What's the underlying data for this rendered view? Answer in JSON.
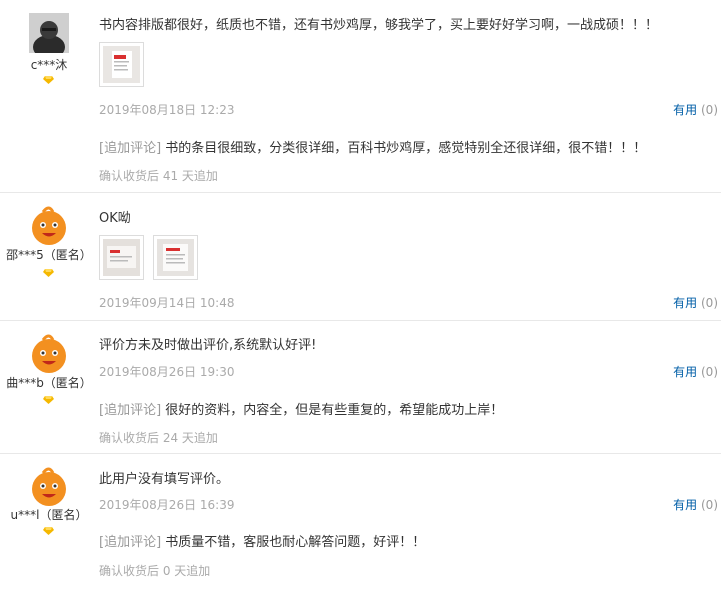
{
  "reviews": [
    {
      "user": "c***沐",
      "content": "书内容排版都很好，纸质也不错，还有书炒鸡厚，够我学了，买上要好好学习啊，一战成硕！！！",
      "date": "2019年08月18日 12:23",
      "useful_label": "有用",
      "useful_count": "(0)",
      "append_tag": "[追加评论]",
      "append_text": "书的条目很细致，分类很详细，百科书炒鸡厚，感觉特别全还很详细，很不错！！！",
      "after": "确认收货后 41 天追加"
    },
    {
      "user": "邵***5（匿名）",
      "content": "OK呦",
      "date": "2019年09月14日 10:48",
      "useful_label": "有用",
      "useful_count": "(0)"
    },
    {
      "user": "曲***b（匿名）",
      "content": "评价方未及时做出评价,系统默认好评!",
      "date": "2019年08月26日 19:30",
      "useful_label": "有用",
      "useful_count": "(0)",
      "append_tag": "[追加评论]",
      "append_text": "很好的资料，内容全，但是有些重复的，希望能成功上岸！",
      "after": "确认收货后 24 天追加"
    },
    {
      "user": "u***l（匿名）",
      "content": "此用户没有填写评价。",
      "date": "2019年08月26日 16:39",
      "useful_label": "有用",
      "useful_count": "(0)",
      "append_tag": "[追加评论]",
      "append_text": "书质量不错，客服也耐心解答问题，好评！！",
      "after": "确认收货后 0 天追加"
    }
  ],
  "colors": {
    "link": "#005ea7",
    "muted": "#aaaaaa",
    "level": "#f5b800",
    "avatar": "#f39020"
  },
  "icons": {
    "avatar_default": "orange-mascot-avatar",
    "avatar_user1": "dark-hooded-avatar",
    "level": "diamond-level-icon"
  }
}
